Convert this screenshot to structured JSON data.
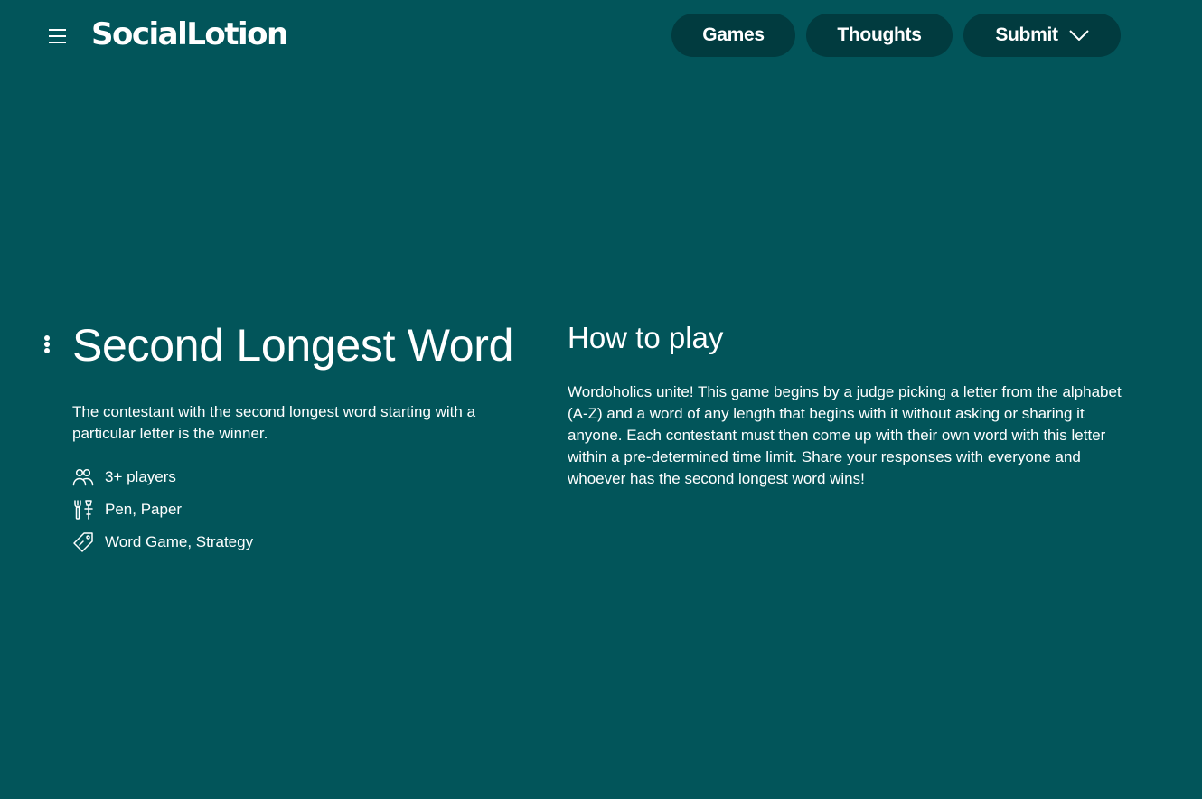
{
  "header": {
    "brand": "SocialLotion",
    "nav": {
      "games": "Games",
      "thoughts": "Thoughts",
      "submit": "Submit"
    }
  },
  "game": {
    "title": "Second Longest Word",
    "summary": "The contestant with the second longest word starting with a particular letter is the winner.",
    "players": "3+ players",
    "items": "Pen, Paper",
    "tags": "Word Game, Strategy"
  },
  "how_to_play": {
    "heading": "How to play",
    "body": "Wordoholics unite! This game begins by a judge picking a letter from the alphabet (A-Z) and a word of any length that begins with it without asking or sharing it anyone. Each contestant must then come up with their own word with this letter within a pre-determined time limit. Share your responses with everyone and whoever has the second longest word wins!"
  },
  "colors": {
    "background": "#02555a",
    "nav_button": "#013b3f",
    "text": "#ffffff"
  },
  "icons": {
    "menu": "hamburger-icon",
    "options": "vertical-dots-icon",
    "players": "users-icon",
    "items": "tools-icon",
    "tags": "tag-icon",
    "dropdown": "chevron-down-icon"
  }
}
